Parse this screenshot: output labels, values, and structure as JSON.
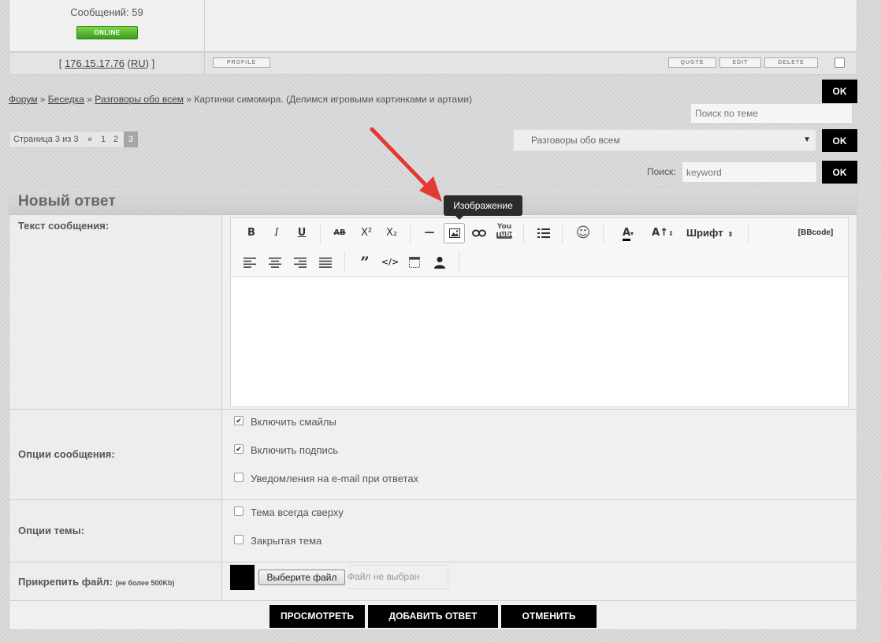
{
  "post": {
    "messages": "Сообщений: 59",
    "online": "ONLINE",
    "ip_prefix": "[ ",
    "ip": "176.15.17.76",
    "country_open": " (",
    "country": "RU",
    "country_close": ") ]",
    "profile": "PROFILE",
    "quote": "QUOTE",
    "edit": "EDIT",
    "delete": "DELETE"
  },
  "breadcrumb": {
    "forum": "Форум",
    "sep": " » ",
    "section": "Беседка",
    "subsection": "Разговоры обо всем",
    "topic": "Картинки симомира. (Делимся игровыми картинками и артами)"
  },
  "topic_search": {
    "placeholder": "Поиск по теме",
    "ok": "OK"
  },
  "pagination": {
    "label": "Страница 3 из 3",
    "prev": "«",
    "pages": [
      "1",
      "2",
      "3"
    ],
    "current": "3"
  },
  "jump": {
    "selected": "Разговоры обо всем",
    "ok": "OK"
  },
  "search": {
    "label": "Поиск:",
    "value": "keyword",
    "ok": "OK"
  },
  "reply": {
    "title": "Новый ответ",
    "text_label": "Текст сообщения:",
    "toolbar": {
      "bold": "B",
      "italic": "I",
      "underline": "U",
      "strike": "AB",
      "sup": "X²",
      "sub": "X₂",
      "hr": "—",
      "font_label": "Шрифт",
      "bbcode": "[BBcode]",
      "font_size": "A↑",
      "font_color": "A",
      "youtube_top": "You",
      "youtube_bottom": "Tube",
      "quote": "”",
      "code": "</>"
    },
    "tooltip": "Изображение",
    "options_label": "Опции сообщения:",
    "options": [
      {
        "label": "Включить смайлы",
        "checked": true
      },
      {
        "label": "Включить подпись",
        "checked": true
      },
      {
        "label": "Уведомления на e-mail при ответах",
        "checked": false
      }
    ],
    "topic_options_label": "Опции темы:",
    "topic_options": [
      {
        "label": "Тема всегда сверху",
        "checked": false
      },
      {
        "label": "Закрытая тема",
        "checked": false
      }
    ],
    "attach_label": "Прикрепить файл:",
    "attach_note": "(не более 500Kb)",
    "file_button": "Выберите файл",
    "file_status": "Файл не выбран",
    "preview": "ПРОСМОТРЕТЬ",
    "submit": "ДОБАВИТЬ ОТВЕТ",
    "cancel": "ОТМЕНИТЬ"
  },
  "colors": {
    "accent": "#000000",
    "online": "#4caf2a",
    "arrow": "#e53935"
  }
}
